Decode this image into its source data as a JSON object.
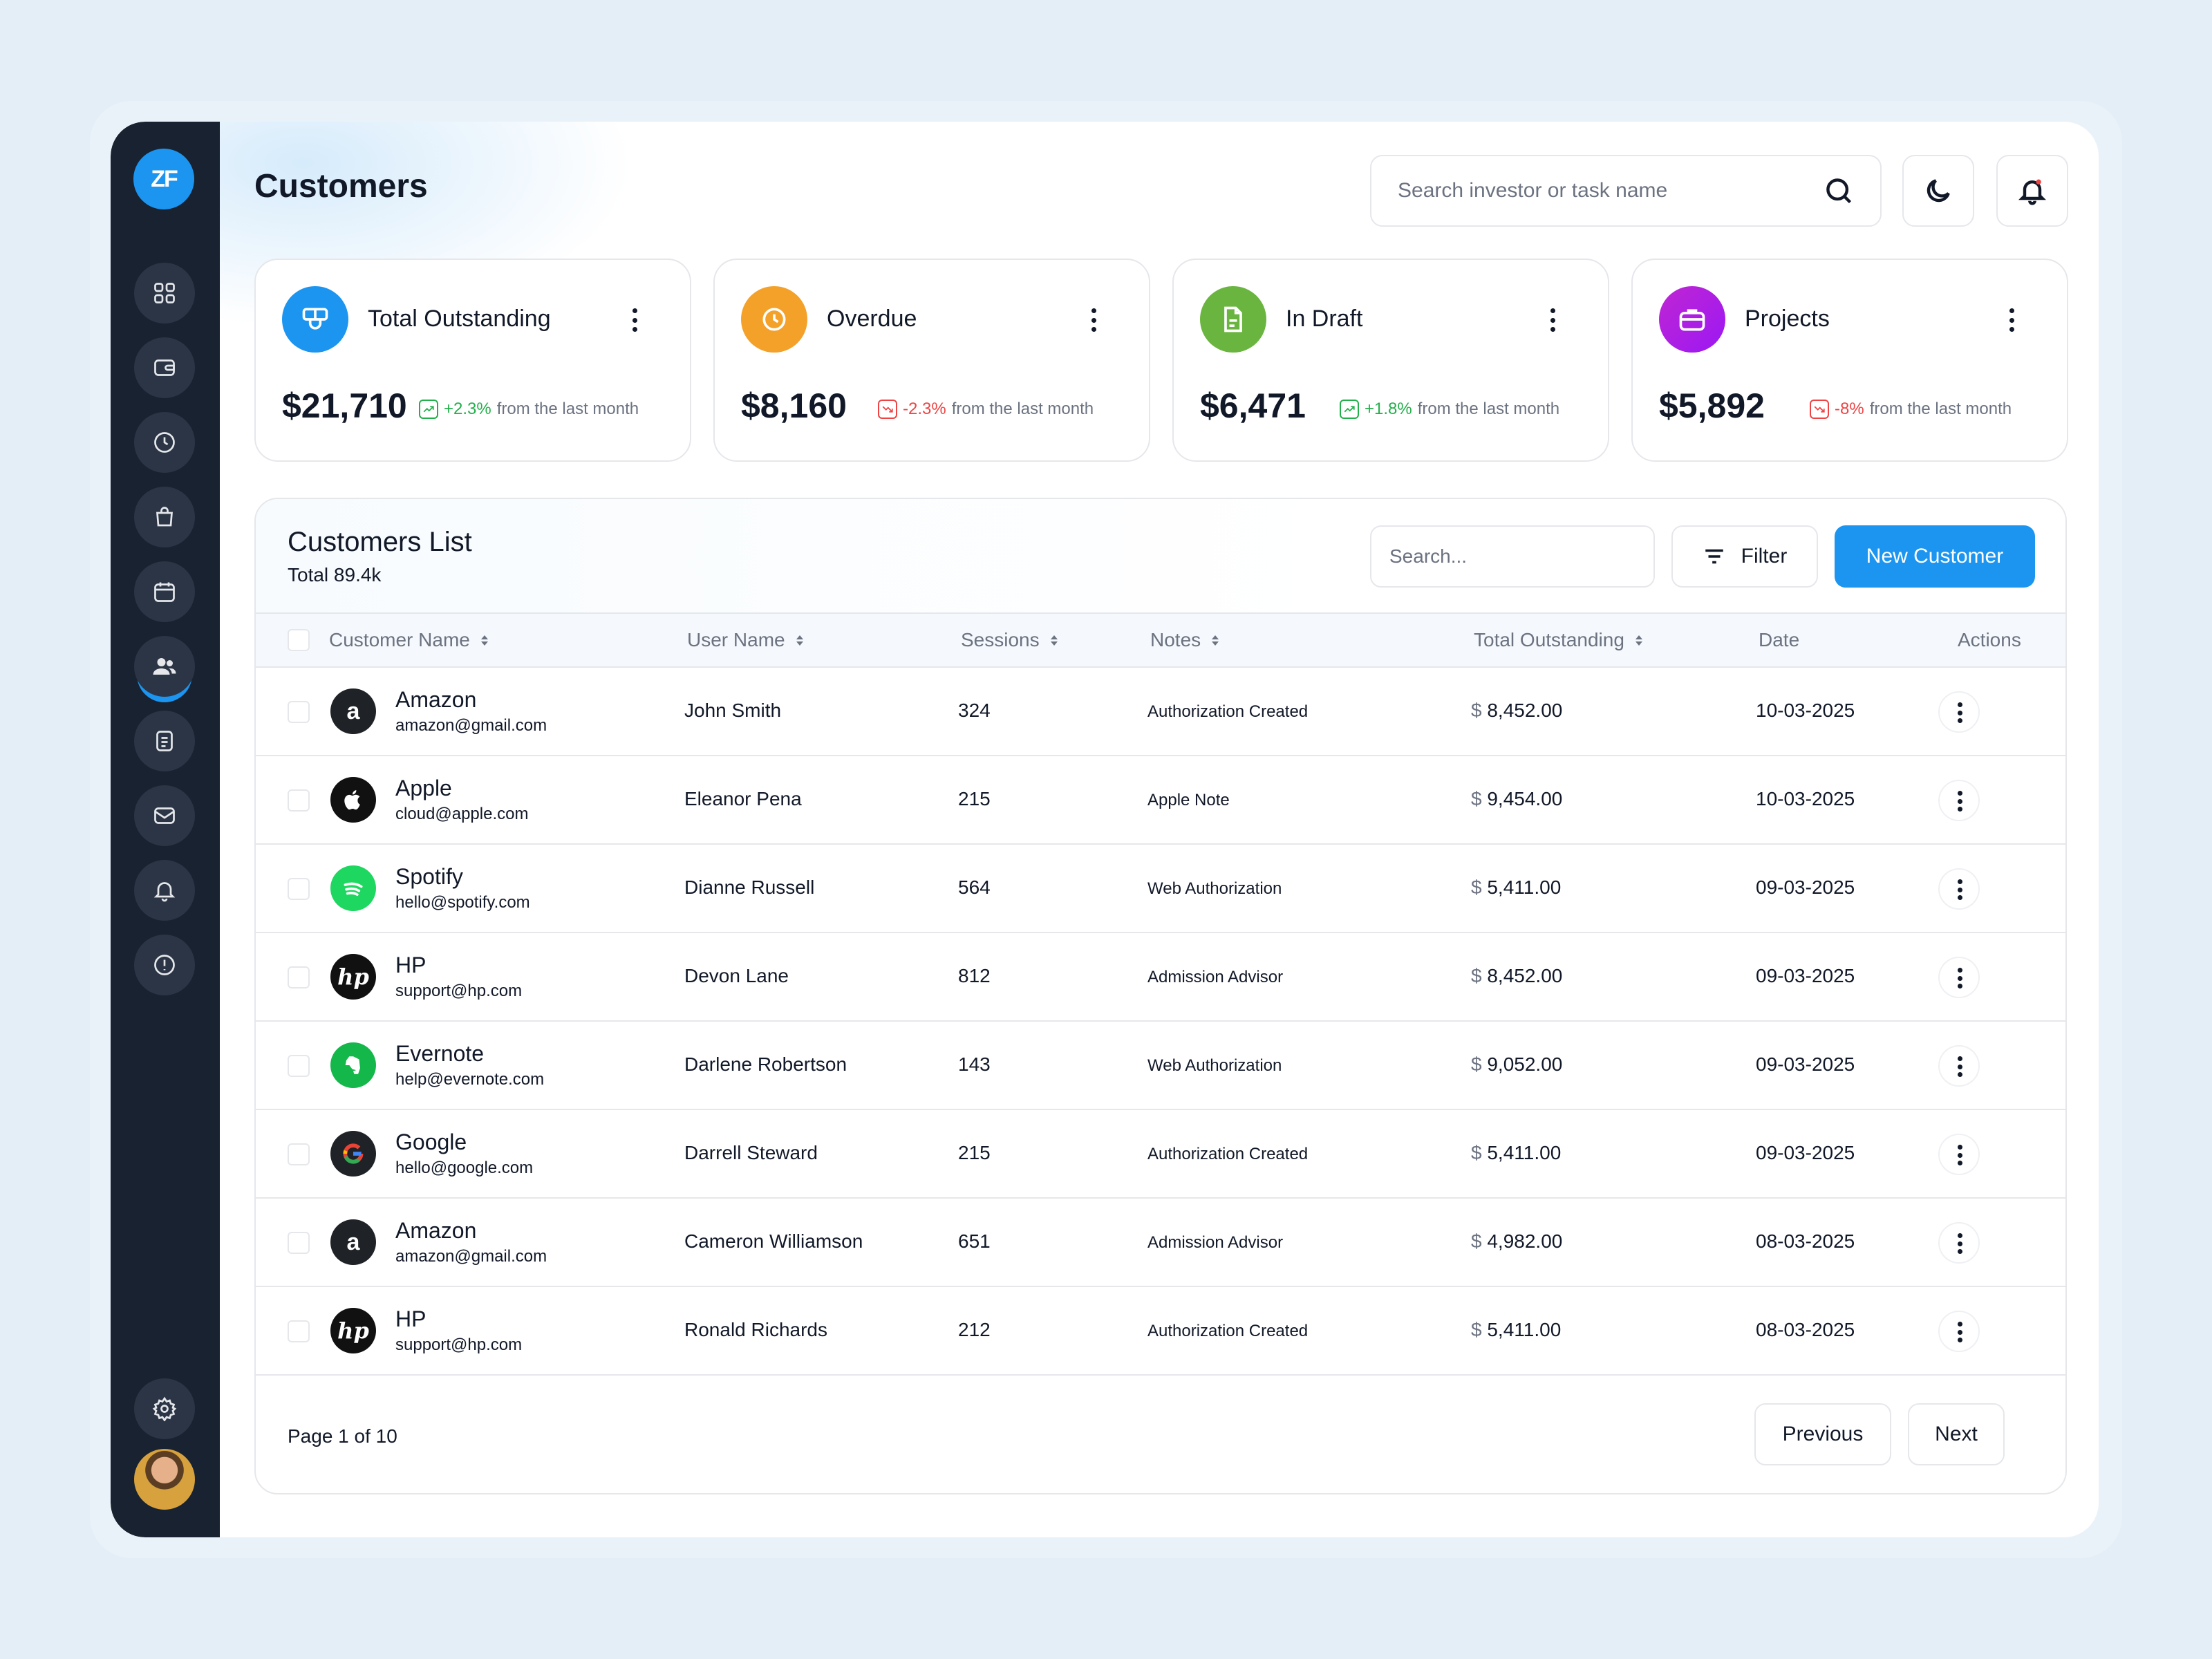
{
  "brand": {
    "logo_text": "ZF"
  },
  "header": {
    "title": "Customers",
    "search_placeholder": "Search investor or task name",
    "theme_icon": "moon-icon",
    "notification_icon": "bell-icon"
  },
  "sidebar": {
    "items": [
      {
        "name": "dashboard",
        "icon": "grid-icon"
      },
      {
        "name": "wallet",
        "icon": "wallet-icon"
      },
      {
        "name": "history",
        "icon": "clock-icon"
      },
      {
        "name": "shop",
        "icon": "bag-icon"
      },
      {
        "name": "calendar",
        "icon": "calendar-icon"
      },
      {
        "name": "customers",
        "icon": "users-icon",
        "active": true
      },
      {
        "name": "documents",
        "icon": "document-icon"
      },
      {
        "name": "mail",
        "icon": "mail-icon"
      },
      {
        "name": "notifications",
        "icon": "bell-icon"
      },
      {
        "name": "info",
        "icon": "alert-icon"
      }
    ],
    "settings_icon": "gear-icon"
  },
  "stats": [
    {
      "label": "Total Outstanding",
      "value": "$21,710",
      "change": "+2.3%",
      "change_suffix": "from the last month",
      "trend": "up",
      "color": "#1b95f0",
      "icon": "presentation-icon"
    },
    {
      "label": "Overdue",
      "value": "$8,160",
      "change": "-2.3%",
      "change_suffix": "from the last month",
      "trend": "down",
      "color": "#f4a12a",
      "icon": "clock-icon"
    },
    {
      "label": "In Draft",
      "value": "$6,471",
      "change": "+1.8%",
      "change_suffix": "from the last month",
      "trend": "up",
      "color": "#6ab53f",
      "icon": "document-icon"
    },
    {
      "label": "Projects",
      "value": "$5,892",
      "change": "-8%",
      "change_suffix": "from the last month",
      "trend": "down",
      "color": "#b517e9",
      "icon": "briefcase-icon"
    }
  ],
  "customers_list": {
    "title": "Customers List",
    "total": "Total 89.4k",
    "search_placeholder": "Search...",
    "filter_label": "Filter",
    "new_label": "New Customer",
    "columns": [
      "Customer Name",
      "User Name",
      "Sessions",
      "Notes",
      "Total Outstanding",
      "Date",
      "Actions"
    ],
    "rows": [
      {
        "name": "Amazon",
        "email": "amazon@gmail.com",
        "user": "John Smith",
        "sessions": "324",
        "notes": "Authorization Created",
        "currency": "$",
        "amount": "8,452.00",
        "date": "10-03-2025",
        "logo": "amazon-logo"
      },
      {
        "name": "Apple",
        "email": "cloud@apple.com",
        "user": "Eleanor Pena",
        "sessions": "215",
        "notes": "Apple Note",
        "currency": "$",
        "amount": "9,454.00",
        "date": "10-03-2025",
        "logo": "apple-logo"
      },
      {
        "name": "Spotify",
        "email": "hello@spotify.com",
        "user": "Dianne Russell",
        "sessions": "564",
        "notes": "Web Authorization",
        "currency": "$",
        "amount": "5,411.00",
        "date": "09-03-2025",
        "logo": "spotify-logo"
      },
      {
        "name": "HP",
        "email": "support@hp.com",
        "user": "Devon Lane",
        "sessions": "812",
        "notes": "Admission Advisor",
        "currency": "$",
        "amount": "8,452.00",
        "date": "09-03-2025",
        "logo": "hp-logo"
      },
      {
        "name": "Evernote",
        "email": "help@evernote.com",
        "user": "Darlene Robertson",
        "sessions": "143",
        "notes": "Web Authorization",
        "currency": "$",
        "amount": "9,052.00",
        "date": "09-03-2025",
        "logo": "evernote-logo"
      },
      {
        "name": "Google",
        "email": "hello@google.com",
        "user": "Darrell Steward",
        "sessions": "215",
        "notes": "Authorization Created",
        "currency": "$",
        "amount": "5,411.00",
        "date": "09-03-2025",
        "logo": "google-logo"
      },
      {
        "name": "Amazon",
        "email": "amazon@gmail.com",
        "user": "Cameron Williamson",
        "sessions": "651",
        "notes": "Admission Advisor",
        "currency": "$",
        "amount": "4,982.00",
        "date": "08-03-2025",
        "logo": "amazon-logo"
      },
      {
        "name": "HP",
        "email": "support@hp.com",
        "user": "Ronald Richards",
        "sessions": "212",
        "notes": "Authorization Created",
        "currency": "$",
        "amount": "5,411.00",
        "date": "08-03-2025",
        "logo": "hp-logo"
      }
    ],
    "pagination": {
      "text": "Page 1 of 10",
      "previous": "Previous",
      "next": "Next"
    }
  },
  "colors": {
    "accent": "#1b95f0",
    "sidebar": "#182230",
    "up": "#22b04b",
    "down": "#ef4444"
  }
}
